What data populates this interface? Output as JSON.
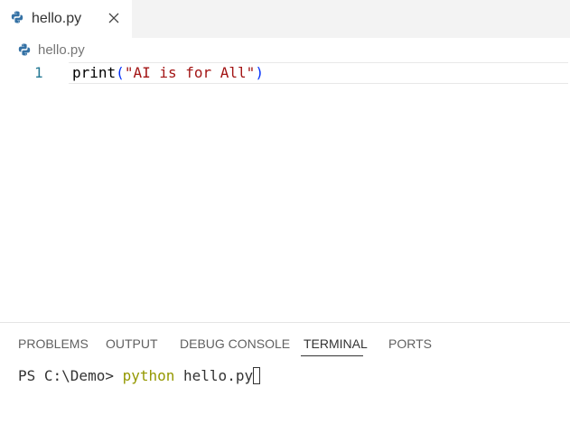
{
  "tabbar": {
    "tabs": [
      {
        "label": "hello.py",
        "icon": "python-icon",
        "close_icon": "close-icon"
      }
    ]
  },
  "breadcrumb": {
    "file": "hello.py",
    "icon": "python-icon"
  },
  "editor": {
    "lines": [
      {
        "number": "1",
        "fn": "print",
        "open_paren": "(",
        "string": "\"AI is for All\"",
        "close_paren": ")"
      }
    ]
  },
  "panel": {
    "tabs": {
      "problems": "PROBLEMS",
      "output": "OUTPUT",
      "debug_console": "DEBUG CONSOLE",
      "terminal": "TERMINAL",
      "ports": "PORTS"
    },
    "active_tab": "TERMINAL",
    "terminal": {
      "prompt": "PS C:\\Demo> ",
      "command": "python",
      "args": " hello.py"
    }
  },
  "colors": {
    "python_icon_blue": "#3572a5",
    "string": "#a31515",
    "paren": "#0431fa",
    "line_number": "#237893",
    "terminal_command": "#949800"
  }
}
